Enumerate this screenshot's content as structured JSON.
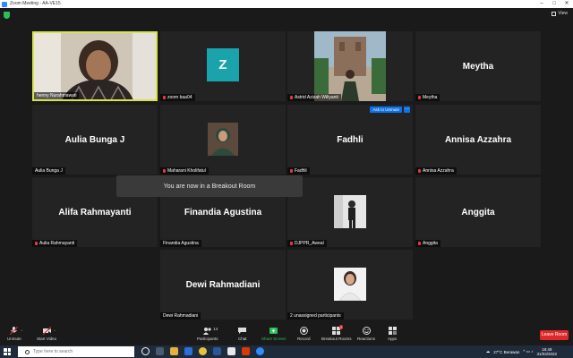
{
  "window": {
    "title": "Zoom Meeting - AA-VE15"
  },
  "view_label": "View",
  "tiles": [
    {
      "id": "t1",
      "name": "henny Nurahmawati",
      "muted": false,
      "type": "video"
    },
    {
      "id": "t2",
      "name": "zoom baa04",
      "muted": true,
      "type": "avatar",
      "avatar_letter": "Z"
    },
    {
      "id": "t3",
      "name": "Astrid Azizah Wiliyanti",
      "muted": true,
      "type": "photo"
    },
    {
      "id": "t4",
      "name": "Meytha",
      "muted": true,
      "type": "name",
      "big_name": "Meytha"
    },
    {
      "id": "t5",
      "name": "Aulia Bunga J",
      "muted": false,
      "type": "name",
      "big_name": "Aulia Bunga J"
    },
    {
      "id": "t6",
      "name": "Maharani Kholifatul",
      "muted": true,
      "type": "photo"
    },
    {
      "id": "t7",
      "name": "Fadhli",
      "muted": true,
      "type": "name",
      "big_name": "Fadhli"
    },
    {
      "id": "t8",
      "name": "Annisa Azzahra",
      "muted": true,
      "type": "name",
      "big_name": "Annisa Azzahra"
    },
    {
      "id": "t9",
      "name": "Aulia Rahmayanti",
      "muted": true,
      "type": "name",
      "big_name": "Alifa Rahmayanti"
    },
    {
      "id": "t10",
      "name": "Finandia Agustina",
      "muted": false,
      "type": "name",
      "big_name": "Finandia Agustina"
    },
    {
      "id": "t11",
      "name": "DJPPR_Aweal",
      "muted": true,
      "type": "photo"
    },
    {
      "id": "t12",
      "name": "Anggita",
      "muted": true,
      "type": "name",
      "big_name": "Anggita"
    },
    {
      "id": "t13",
      "name": "Dewi Rahmadiani",
      "muted": false,
      "type": "name",
      "big_name": "Dewi Rahmadiani"
    },
    {
      "id": "t14",
      "name": "2 unassigned participants",
      "muted": false,
      "type": "photo"
    }
  ],
  "ask_to_unmute": "Ask to Unmute",
  "more": "···",
  "toast": "You are now in a Breakout Room",
  "toolbar": {
    "unmute": "Unmute",
    "start_video": "Start Video",
    "participants": "Participants",
    "participants_count": "14",
    "chat": "Chat",
    "share_screen": "Share Screen",
    "record": "Record",
    "breakout_rooms": "Breakout Rooms",
    "breakout_badge": "2",
    "reactions": "Reactions",
    "apps": "Apps",
    "leave_room": "Leave Room"
  },
  "taskbar": {
    "search_placeholder": "Type here to search",
    "weather": "27°C Berawan",
    "time": "18:49",
    "date": "31/03/2022"
  },
  "colors": {
    "active_border": "#d7e34a",
    "zoom_blue": "#0e72ed",
    "leave_red": "#e02828",
    "share_green": "#2dbd5a"
  }
}
